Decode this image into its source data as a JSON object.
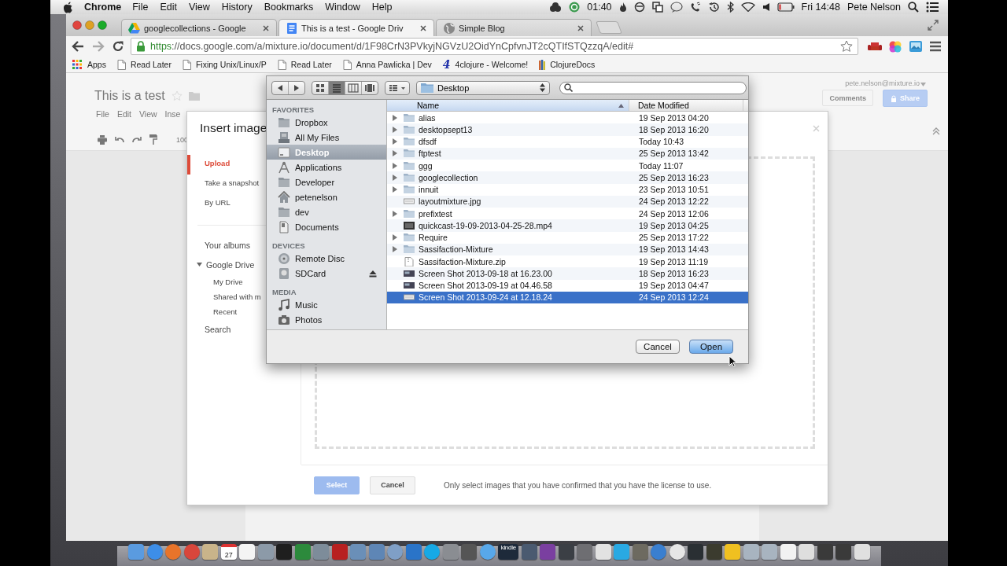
{
  "menu_bar": {
    "app": "Chrome",
    "menus": [
      "File",
      "Edit",
      "View",
      "History",
      "Bookmarks",
      "Window",
      "Help"
    ],
    "timer": "01:40",
    "clock": "Fri 14:48",
    "user": "Pete Nelson"
  },
  "browser": {
    "tabs": [
      {
        "title": "googlecollections - Google",
        "kind": "drive",
        "selected": false
      },
      {
        "title": "This is a test - Google Driv",
        "kind": "doc",
        "selected": true
      },
      {
        "title": "Simple Blog",
        "kind": "globe",
        "selected": false
      }
    ],
    "address": {
      "scheme": "https",
      "rest": "://docs.google.com/a/mixture.io/document/d/1F98CrN3PVkyjNGVzU2OidYnCpfvnJT2cQTIfSTQzzqA/edit#"
    },
    "bookmarks": [
      {
        "kind": "apps",
        "label": "Apps"
      },
      {
        "kind": "page",
        "label": "Read Later"
      },
      {
        "kind": "page",
        "label": "Fixing Unix/Linux/P"
      },
      {
        "kind": "page",
        "label": "Read Later"
      },
      {
        "kind": "page",
        "label": "Anna Pawlicka | Dev"
      },
      {
        "kind": "mark",
        "mark": "4",
        "label": "4clojure - Welcome!"
      },
      {
        "kind": "docs",
        "label": "ClojureDocs"
      }
    ]
  },
  "docs": {
    "title": "This is a test",
    "account": "pete.nelson@mixture.io",
    "menus": [
      "File",
      "Edit",
      "View",
      "Inse"
    ],
    "zoom": "100",
    "comments": "Comments",
    "share": "Share"
  },
  "insert_image": {
    "title": "Insert image",
    "nav": [
      {
        "label": "Upload",
        "selected": true
      },
      {
        "label": "Take a snapshot",
        "selected": false
      },
      {
        "label": "By URL",
        "selected": false
      }
    ],
    "sources": [
      {
        "label": "Your albums"
      },
      {
        "label": "Google Drive",
        "expanded": true,
        "children": [
          {
            "label": "My Drive"
          },
          {
            "label": "Shared with m"
          },
          {
            "label": "Recent"
          }
        ]
      },
      {
        "label": "Search"
      }
    ],
    "select_button": {
      "label": "Select",
      "disabled": true
    },
    "cancel_button": {
      "label": "Cancel"
    },
    "note": "Only select images that you have confirmed that you have the license to use."
  },
  "file_dialog": {
    "view_modes": [
      {
        "kind": "icons",
        "selected": false
      },
      {
        "kind": "list",
        "selected": true
      },
      {
        "kind": "columns",
        "selected": false
      },
      {
        "kind": "coverflow",
        "selected": false
      }
    ],
    "location": "Desktop",
    "sections": [
      {
        "heading": "FAVORITES",
        "items": [
          {
            "label": "Dropbox",
            "kind": "folder",
            "selected": false
          },
          {
            "label": "All My Files",
            "kind": "files",
            "selected": false
          },
          {
            "label": "Desktop",
            "kind": "desktop",
            "selected": true
          },
          {
            "label": "Applications",
            "kind": "apps",
            "selected": false
          },
          {
            "label": "Developer",
            "kind": "folder",
            "selected": false
          },
          {
            "label": "petenelson",
            "kind": "home",
            "selected": false
          },
          {
            "label": "dev",
            "kind": "folder",
            "selected": false
          },
          {
            "label": "Documents",
            "kind": "documents",
            "selected": false
          }
        ]
      },
      {
        "heading": "DEVICES",
        "items": [
          {
            "label": "Remote Disc",
            "kind": "disc",
            "selected": false,
            "ejectable": false
          },
          {
            "label": "SDCard",
            "kind": "drive",
            "selected": false,
            "ejectable": true
          }
        ]
      },
      {
        "heading": "MEDIA",
        "items": [
          {
            "label": "Music",
            "kind": "music",
            "selected": false
          },
          {
            "label": "Photos",
            "kind": "camera",
            "selected": false
          }
        ]
      }
    ],
    "columns": [
      {
        "label": "Name",
        "sorted": true
      },
      {
        "label": "Date Modified",
        "sorted": false
      }
    ],
    "rows": [
      {
        "name": "alias",
        "kind": "folder",
        "date": "19 Sep 2013 04:20",
        "selected": false
      },
      {
        "name": "desktopsept13",
        "kind": "folder",
        "date": "18 Sep 2013 16:20",
        "selected": false
      },
      {
        "name": "dfsdf",
        "kind": "folder",
        "date": "Today 10:43",
        "selected": false
      },
      {
        "name": "ftptest",
        "kind": "folder",
        "date": "25 Sep 2013 13:42",
        "selected": false
      },
      {
        "name": "ggg",
        "kind": "folder",
        "date": "Today 11:07",
        "selected": false
      },
      {
        "name": "googlecollection",
        "kind": "folder",
        "date": "25 Sep 2013 16:23",
        "selected": false
      },
      {
        "name": "innuit",
        "kind": "folder",
        "date": "23 Sep 2013 10:51",
        "selected": false
      },
      {
        "name": "layoutmixture.jpg",
        "kind": "image",
        "date": "24 Sep 2013 12:22",
        "selected": false
      },
      {
        "name": "prefixtest",
        "kind": "folder",
        "date": "24 Sep 2013 12:06",
        "selected": false
      },
      {
        "name": "quickcast-19-09-2013-04-25-28.mp4",
        "kind": "video",
        "date": "19 Sep 2013 04:25",
        "selected": false
      },
      {
        "name": "Require",
        "kind": "folder",
        "date": "25 Sep 2013 17:22",
        "selected": false
      },
      {
        "name": "Sassifaction-Mixture",
        "kind": "folder",
        "date": "19 Sep 2013 14:43",
        "selected": false
      },
      {
        "name": "Sassifaction-Mixture.zip",
        "kind": "zip",
        "date": "19 Sep 2013 11:19",
        "selected": false
      },
      {
        "name": "Screen Shot 2013-09-18 at 16.23.00",
        "kind": "screenshot",
        "date": "18 Sep 2013 16:23",
        "selected": false
      },
      {
        "name": "Screen Shot 2013-09-19 at 04.46.58",
        "kind": "screenshot",
        "date": "19 Sep 2013 04:47",
        "selected": false
      },
      {
        "name": "Screen Shot 2013-09-24 at 12.18.24",
        "kind": "image",
        "date": "24 Sep 2013 12:24",
        "selected": true
      }
    ],
    "buttons": [
      {
        "label": "Cancel",
        "default": false
      },
      {
        "label": "Open",
        "default": true
      }
    ]
  },
  "dock": {
    "calendar_day": "27",
    "kindle_label": "kindle"
  }
}
